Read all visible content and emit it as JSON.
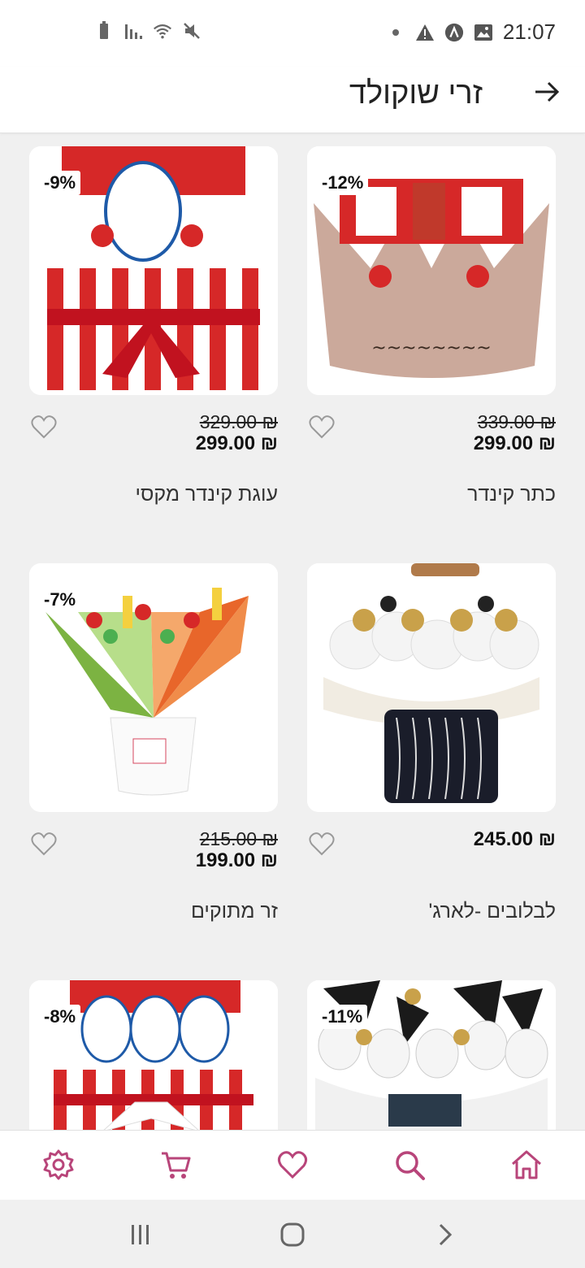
{
  "status_bar": {
    "time": "21:07",
    "left_icons": [
      "battery-icon",
      "signal-icon",
      "wifi-icon",
      "mute-icon"
    ],
    "right_icons": [
      "dot-icon",
      "warning-icon",
      "app-icon",
      "image-icon"
    ]
  },
  "header": {
    "title": "זרי שוקולד",
    "back_icon": "arrow-right-icon"
  },
  "products": [
    {
      "name": "כתר קינדר",
      "old_price": "₪ 339.00",
      "price": "₪ 299.00",
      "discount": "-12%"
    },
    {
      "name": "עוגת קינדר מקסי",
      "old_price": "₪ 329.00",
      "price": "₪ 299.00",
      "discount": "-9%"
    },
    {
      "name": "לבלובים -לארג'",
      "old_price": "",
      "price": "₪ 245.00",
      "discount": ""
    },
    {
      "name": "זר מתוקים",
      "old_price": "₪ 215.00",
      "price": "₪ 199.00",
      "discount": "-7%"
    },
    {
      "name": "",
      "old_price": "",
      "price": "",
      "discount": "-11%"
    },
    {
      "name": "",
      "old_price": "",
      "price": "",
      "discount": "-8%"
    }
  ],
  "bottom_nav": {
    "items": [
      "home-icon",
      "search-icon",
      "heart-icon",
      "cart-icon",
      "settings-icon"
    ],
    "accent_color": "#b8457a"
  },
  "system_nav": [
    "back-icon",
    "home-circle-icon",
    "recents-icon"
  ]
}
